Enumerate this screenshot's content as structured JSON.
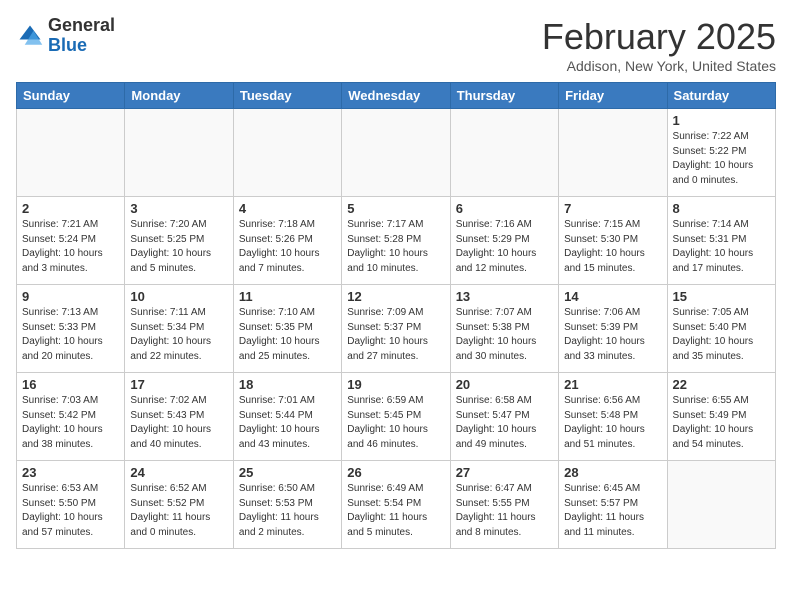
{
  "header": {
    "logo_line1": "General",
    "logo_line2": "Blue",
    "month": "February 2025",
    "location": "Addison, New York, United States"
  },
  "days_of_week": [
    "Sunday",
    "Monday",
    "Tuesday",
    "Wednesday",
    "Thursday",
    "Friday",
    "Saturday"
  ],
  "weeks": [
    [
      {
        "num": "",
        "info": ""
      },
      {
        "num": "",
        "info": ""
      },
      {
        "num": "",
        "info": ""
      },
      {
        "num": "",
        "info": ""
      },
      {
        "num": "",
        "info": ""
      },
      {
        "num": "",
        "info": ""
      },
      {
        "num": "1",
        "info": "Sunrise: 7:22 AM\nSunset: 5:22 PM\nDaylight: 10 hours\nand 0 minutes."
      }
    ],
    [
      {
        "num": "2",
        "info": "Sunrise: 7:21 AM\nSunset: 5:24 PM\nDaylight: 10 hours\nand 3 minutes."
      },
      {
        "num": "3",
        "info": "Sunrise: 7:20 AM\nSunset: 5:25 PM\nDaylight: 10 hours\nand 5 minutes."
      },
      {
        "num": "4",
        "info": "Sunrise: 7:18 AM\nSunset: 5:26 PM\nDaylight: 10 hours\nand 7 minutes."
      },
      {
        "num": "5",
        "info": "Sunrise: 7:17 AM\nSunset: 5:28 PM\nDaylight: 10 hours\nand 10 minutes."
      },
      {
        "num": "6",
        "info": "Sunrise: 7:16 AM\nSunset: 5:29 PM\nDaylight: 10 hours\nand 12 minutes."
      },
      {
        "num": "7",
        "info": "Sunrise: 7:15 AM\nSunset: 5:30 PM\nDaylight: 10 hours\nand 15 minutes."
      },
      {
        "num": "8",
        "info": "Sunrise: 7:14 AM\nSunset: 5:31 PM\nDaylight: 10 hours\nand 17 minutes."
      }
    ],
    [
      {
        "num": "9",
        "info": "Sunrise: 7:13 AM\nSunset: 5:33 PM\nDaylight: 10 hours\nand 20 minutes."
      },
      {
        "num": "10",
        "info": "Sunrise: 7:11 AM\nSunset: 5:34 PM\nDaylight: 10 hours\nand 22 minutes."
      },
      {
        "num": "11",
        "info": "Sunrise: 7:10 AM\nSunset: 5:35 PM\nDaylight: 10 hours\nand 25 minutes."
      },
      {
        "num": "12",
        "info": "Sunrise: 7:09 AM\nSunset: 5:37 PM\nDaylight: 10 hours\nand 27 minutes."
      },
      {
        "num": "13",
        "info": "Sunrise: 7:07 AM\nSunset: 5:38 PM\nDaylight: 10 hours\nand 30 minutes."
      },
      {
        "num": "14",
        "info": "Sunrise: 7:06 AM\nSunset: 5:39 PM\nDaylight: 10 hours\nand 33 minutes."
      },
      {
        "num": "15",
        "info": "Sunrise: 7:05 AM\nSunset: 5:40 PM\nDaylight: 10 hours\nand 35 minutes."
      }
    ],
    [
      {
        "num": "16",
        "info": "Sunrise: 7:03 AM\nSunset: 5:42 PM\nDaylight: 10 hours\nand 38 minutes."
      },
      {
        "num": "17",
        "info": "Sunrise: 7:02 AM\nSunset: 5:43 PM\nDaylight: 10 hours\nand 40 minutes."
      },
      {
        "num": "18",
        "info": "Sunrise: 7:01 AM\nSunset: 5:44 PM\nDaylight: 10 hours\nand 43 minutes."
      },
      {
        "num": "19",
        "info": "Sunrise: 6:59 AM\nSunset: 5:45 PM\nDaylight: 10 hours\nand 46 minutes."
      },
      {
        "num": "20",
        "info": "Sunrise: 6:58 AM\nSunset: 5:47 PM\nDaylight: 10 hours\nand 49 minutes."
      },
      {
        "num": "21",
        "info": "Sunrise: 6:56 AM\nSunset: 5:48 PM\nDaylight: 10 hours\nand 51 minutes."
      },
      {
        "num": "22",
        "info": "Sunrise: 6:55 AM\nSunset: 5:49 PM\nDaylight: 10 hours\nand 54 minutes."
      }
    ],
    [
      {
        "num": "23",
        "info": "Sunrise: 6:53 AM\nSunset: 5:50 PM\nDaylight: 10 hours\nand 57 minutes."
      },
      {
        "num": "24",
        "info": "Sunrise: 6:52 AM\nSunset: 5:52 PM\nDaylight: 11 hours\nand 0 minutes."
      },
      {
        "num": "25",
        "info": "Sunrise: 6:50 AM\nSunset: 5:53 PM\nDaylight: 11 hours\nand 2 minutes."
      },
      {
        "num": "26",
        "info": "Sunrise: 6:49 AM\nSunset: 5:54 PM\nDaylight: 11 hours\nand 5 minutes."
      },
      {
        "num": "27",
        "info": "Sunrise: 6:47 AM\nSunset: 5:55 PM\nDaylight: 11 hours\nand 8 minutes."
      },
      {
        "num": "28",
        "info": "Sunrise: 6:45 AM\nSunset: 5:57 PM\nDaylight: 11 hours\nand 11 minutes."
      },
      {
        "num": "",
        "info": ""
      }
    ]
  ]
}
